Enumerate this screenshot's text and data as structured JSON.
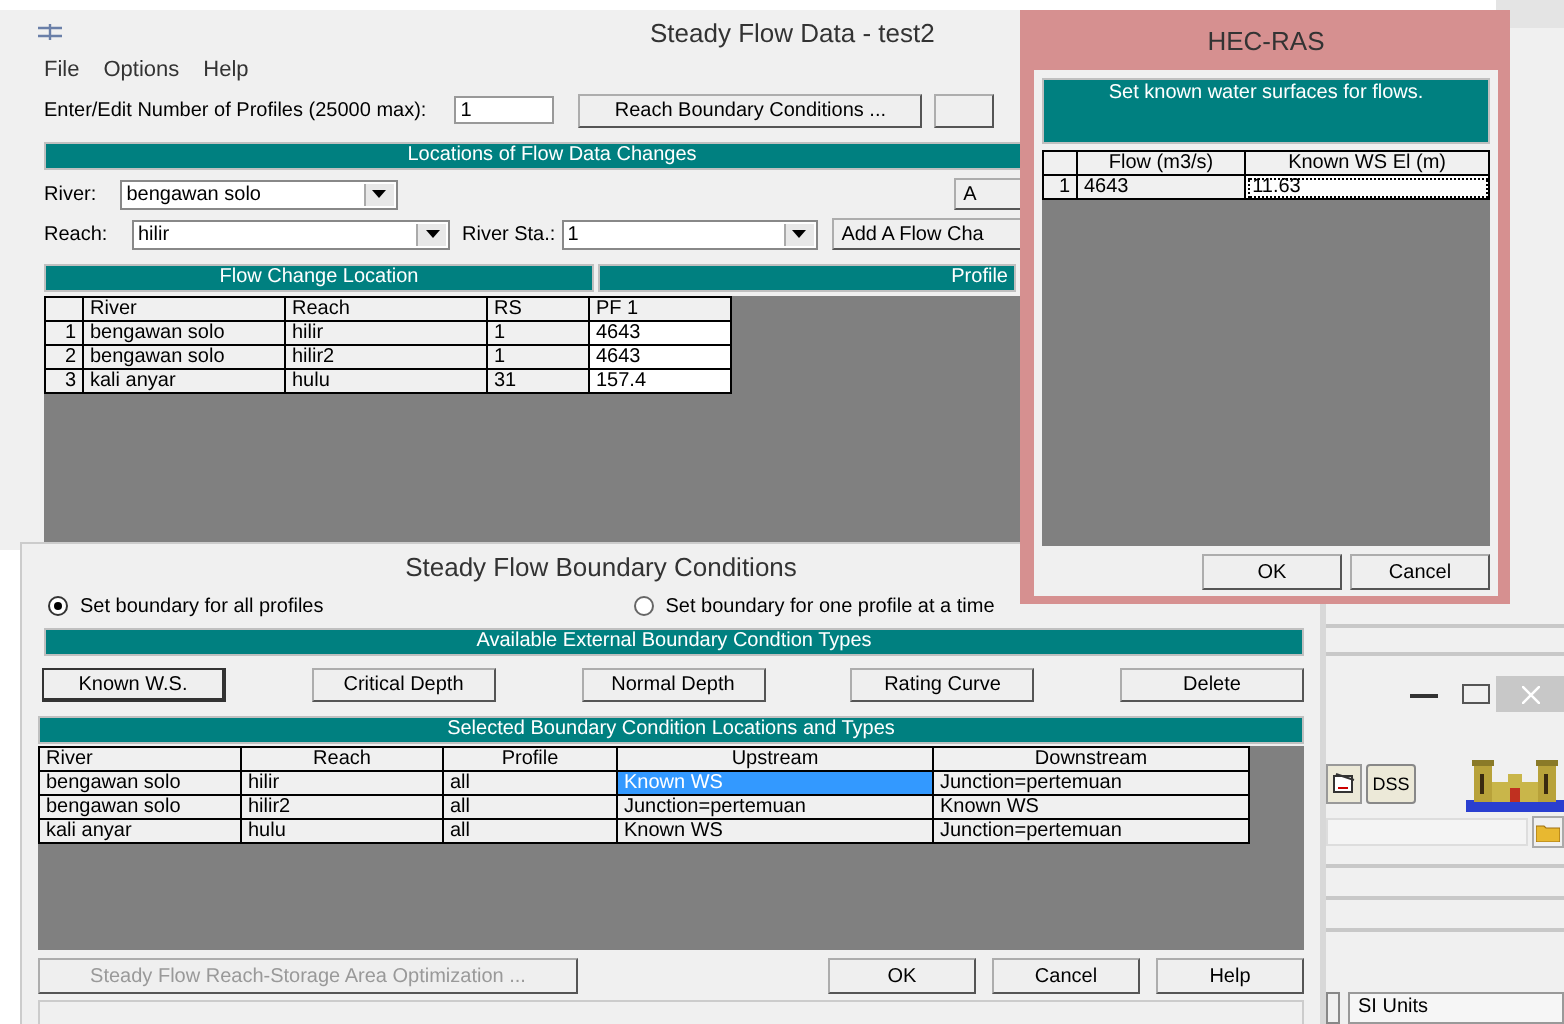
{
  "flow_window": {
    "title": "Steady Flow Data - test2",
    "menu": [
      "File",
      "Options",
      "Help"
    ],
    "profiles_label": "Enter/Edit Number of Profiles (25000 max):",
    "profiles_value": "1",
    "reach_bc_button": "Reach Boundary Conditions ...",
    "locations_header": "Locations of Flow Data Changes",
    "river_label": "River:",
    "river_value": "bengawan solo",
    "partial_button": "A",
    "reach_label": "Reach:",
    "reach_value": "hilir",
    "river_sta_label": "River Sta.:",
    "river_sta_value": "1",
    "add_flow_button": "Add A Flow Cha",
    "location_header": "Flow Change Location",
    "profile_header": "Profile",
    "table": {
      "columns": [
        "River",
        "Reach",
        "RS",
        "PF 1"
      ],
      "rows": [
        {
          "index": "1",
          "cells": [
            "bengawan solo",
            "hilir",
            "1",
            "4643"
          ]
        },
        {
          "index": "2",
          "cells": [
            "bengawan solo",
            "hilir2",
            "1",
            "4643"
          ]
        },
        {
          "index": "3",
          "cells": [
            "kali anyar",
            "hulu",
            "31",
            "157.4"
          ]
        }
      ]
    }
  },
  "hecras_dialog": {
    "title": "HEC-RAS",
    "message": "Set known water surfaces for flows.",
    "columns": [
      "Flow (m3/s)",
      "Known WS El (m)"
    ],
    "rows": [
      {
        "index": "1",
        "flow": "4643",
        "known_ws": "11.63"
      }
    ],
    "buttons": [
      "OK",
      "Cancel"
    ]
  },
  "boundary_dialog": {
    "title": "Steady Flow Boundary Conditions",
    "radios": [
      {
        "label": "Set boundary for all profiles",
        "selected": true
      },
      {
        "label": "Set boundary for one profile at a time",
        "selected": false
      }
    ],
    "types_header": "Available External Boundary Condtion Types",
    "type_buttons": [
      "Known W.S.",
      "Critical Depth",
      "Normal Depth",
      "Rating Curve",
      "Delete"
    ],
    "locations_header": "Selected Boundary Condition Locations and Types",
    "table": {
      "columns": [
        "River",
        "Reach",
        "Profile",
        "Upstream",
        "Downstream"
      ],
      "rows": [
        {
          "cells": [
            {
              "text": "bengawan solo",
              "selected": false
            },
            {
              "text": "hilir",
              "selected": false
            },
            {
              "text": "all",
              "selected": false
            },
            {
              "text": "Known WS",
              "selected": true
            },
            {
              "text": "Junction=pertemuan",
              "selected": false
            }
          ]
        },
        {
          "cells": [
            {
              "text": "bengawan solo",
              "selected": false
            },
            {
              "text": "hilir2",
              "selected": false
            },
            {
              "text": "all",
              "selected": false
            },
            {
              "text": "Junction=pertemuan",
              "selected": false
            },
            {
              "text": "Known WS",
              "selected": false
            }
          ]
        },
        {
          "cells": [
            {
              "text": "kali anyar",
              "selected": false
            },
            {
              "text": "hulu",
              "selected": false
            },
            {
              "text": "all",
              "selected": false
            },
            {
              "text": "Known WS",
              "selected": false
            },
            {
              "text": "Junction=pertemuan",
              "selected": false
            }
          ]
        }
      ]
    },
    "optimization_button": {
      "label": "Steady Flow Reach-Storage Area Optimization ...",
      "disabled": true
    },
    "buttons": [
      "OK",
      "Cancel",
      "Help"
    ]
  },
  "main_window": {
    "dss_button": "DSS",
    "units_value": "SI Units"
  }
}
